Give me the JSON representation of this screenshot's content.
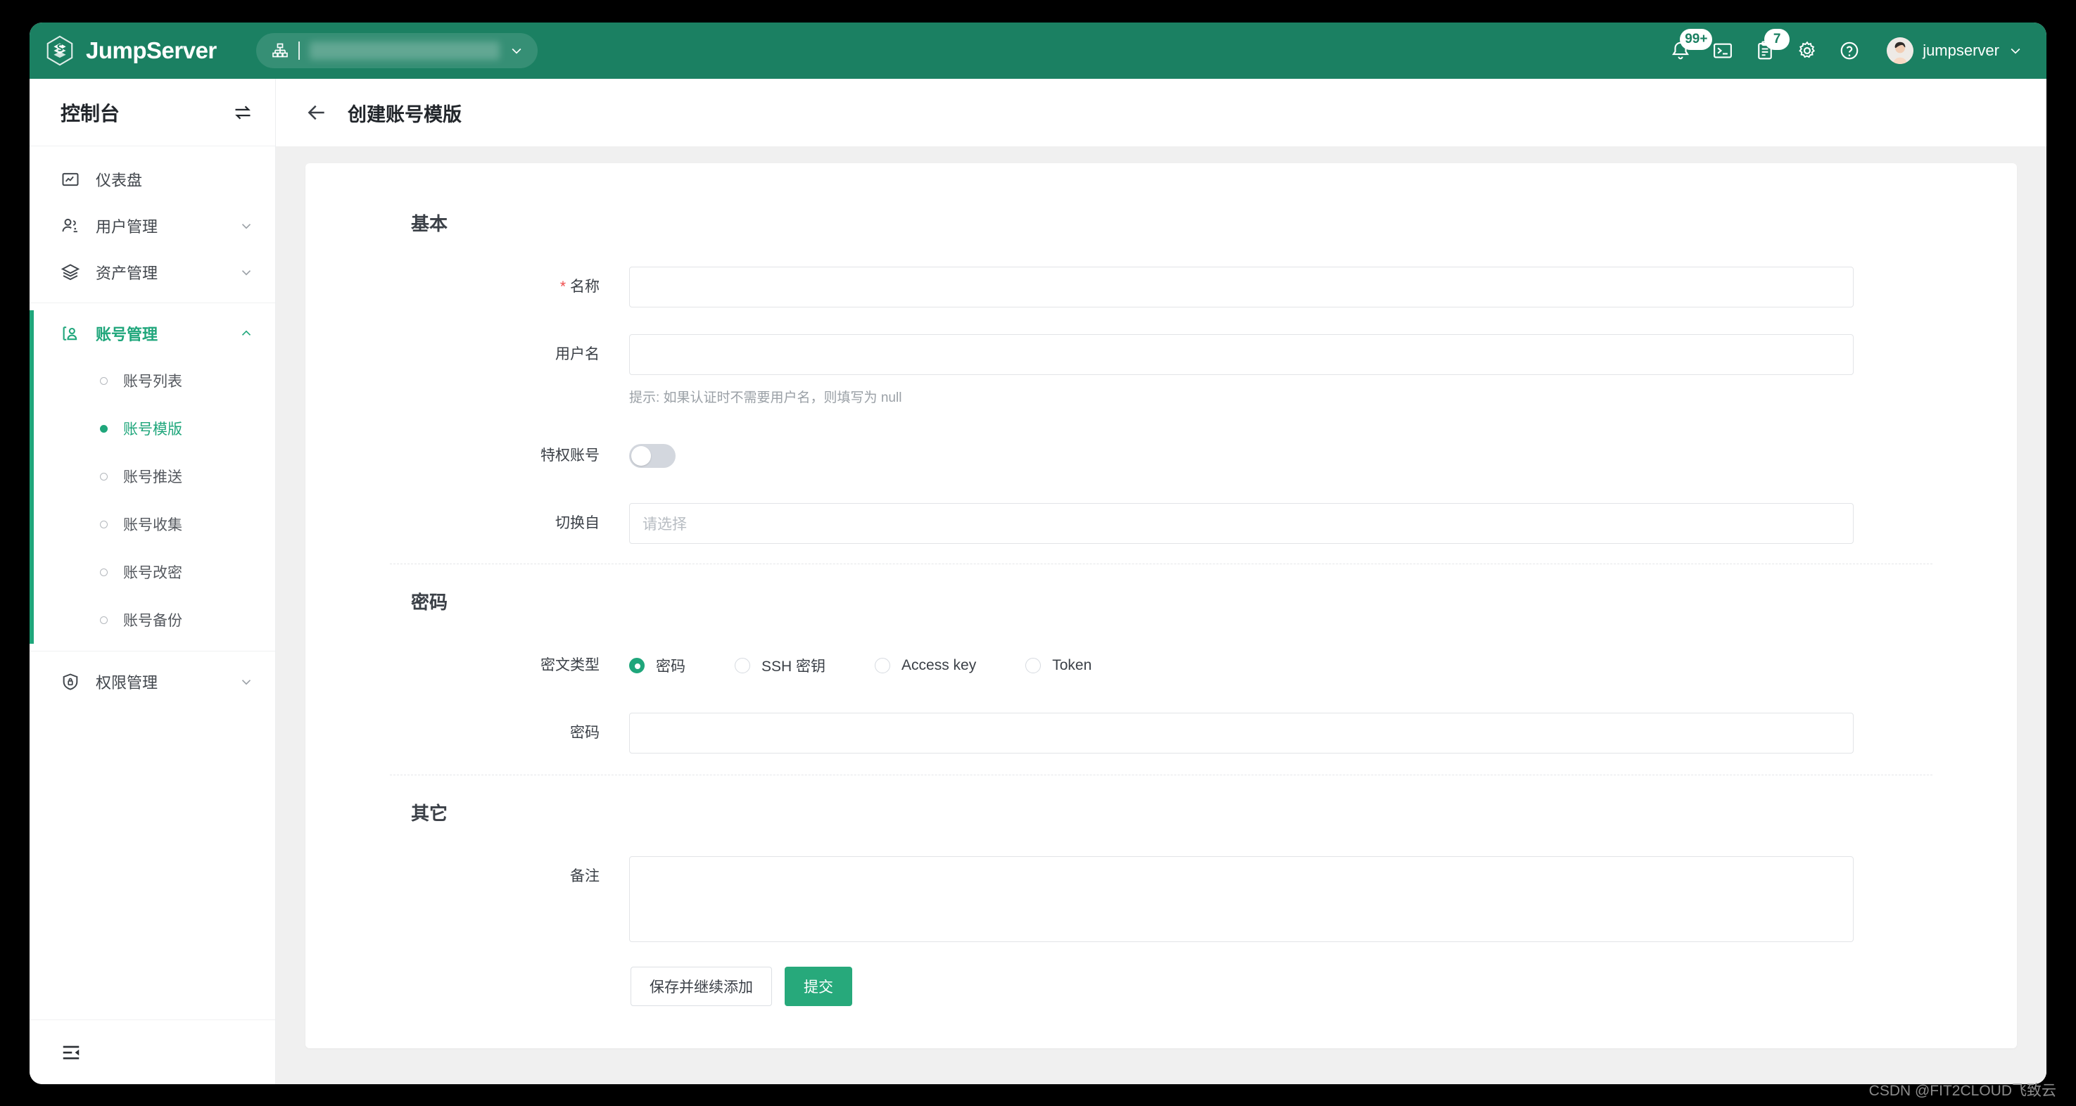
{
  "header": {
    "brand_name": "JumpServer",
    "logo_icon": "jumpserver-hexagon-logo",
    "org_selector": {
      "icon": "org-tree-icon",
      "value": "",
      "chevron_icon": "chevron-down-icon"
    },
    "icons": [
      {
        "name": "bell-icon",
        "badge": "99+"
      },
      {
        "name": "terminal-icon",
        "badge": ""
      },
      {
        "name": "clipboard-icon",
        "badge": "7"
      },
      {
        "name": "gear-icon",
        "badge": ""
      },
      {
        "name": "help-circle-icon",
        "badge": ""
      }
    ],
    "user": {
      "name": "jumpserver",
      "avatar_icon": "avatar",
      "caret_icon": "chevron-down-icon"
    },
    "bg_color": "#1b8062"
  },
  "sidebar": {
    "title": "控制台",
    "swap_icon": "swap-arrows-icon",
    "fold_icon": "menu-fold-icon",
    "items": [
      {
        "label": "仪表盘",
        "icon": "dashboard-icon",
        "expandable": false
      },
      {
        "label": "用户管理",
        "icon": "users-icon",
        "expandable": true,
        "caret": "chevron-down-icon"
      },
      {
        "label": "资产管理",
        "icon": "layers-icon",
        "expandable": true,
        "caret": "chevron-down-icon"
      },
      {
        "label": "账号管理",
        "icon": "id-card-icon",
        "expandable": true,
        "caret": "chevron-up-icon",
        "active": true
      },
      {
        "label": "权限管理",
        "icon": "shield-lock-icon",
        "expandable": true,
        "caret": "chevron-down-icon"
      }
    ],
    "account_subitems": [
      {
        "label": "账号列表",
        "active": false
      },
      {
        "label": "账号模版",
        "active": true
      },
      {
        "label": "账号推送",
        "active": false
      },
      {
        "label": "账号收集",
        "active": false
      },
      {
        "label": "账号改密",
        "active": false
      },
      {
        "label": "账号备份",
        "active": false
      }
    ],
    "accent_color": "#1fa67b"
  },
  "page": {
    "back_icon": "arrow-left-icon",
    "title": "创建账号模版"
  },
  "form": {
    "sections": {
      "basic_title": "基本",
      "password_title": "密码",
      "other_title": "其它"
    },
    "name_label": "名称",
    "name_required_mark": "*",
    "name_value": "",
    "name_placeholder": "",
    "username_label": "用户名",
    "username_value": "",
    "username_placeholder": "",
    "username_hint": "提示: 如果认证时不需要用户名，则填写为 null",
    "privileged_label": "特权账号",
    "privileged_on": false,
    "su_from_label": "切换自",
    "su_from_placeholder": "请选择",
    "secret_type_label": "密文类型",
    "secret_type_options": [
      {
        "label": "密码",
        "selected": true
      },
      {
        "label": "SSH 密钥",
        "selected": false
      },
      {
        "label": "Access key",
        "selected": false
      },
      {
        "label": "Token",
        "selected": false
      }
    ],
    "password_label": "密码",
    "password_value": "",
    "password_placeholder": "",
    "comment_label": "备注",
    "comment_value": "",
    "comment_placeholder": "",
    "save_continue_label": "保存并继续添加",
    "submit_label": "提交",
    "primary_color": "#27a97b"
  },
  "watermark": "CSDN @FIT2CLOUD飞致云"
}
